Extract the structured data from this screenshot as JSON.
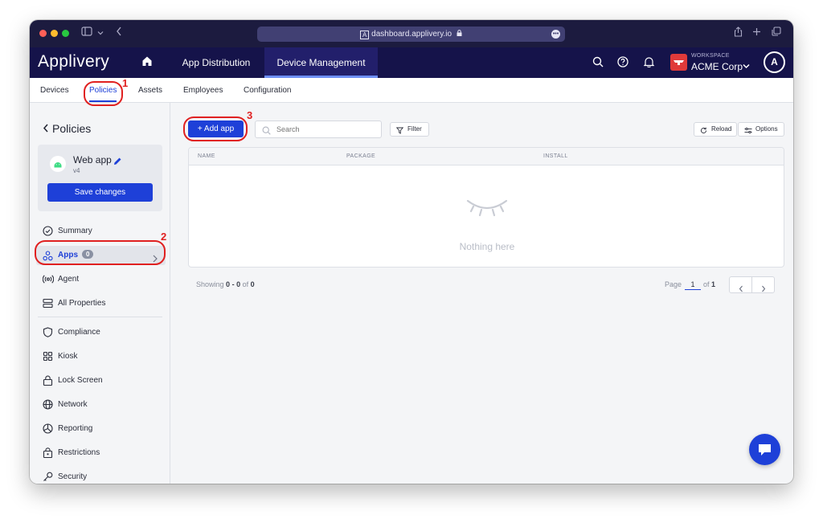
{
  "browser": {
    "url": "dashboard.applivery.io"
  },
  "header": {
    "brand": "Applivery",
    "nav": [
      "App Distribution",
      "Device Management"
    ],
    "workspace_caption": "WORKSPACE",
    "workspace_name": "ACME Corp",
    "avatar_letter": "A"
  },
  "subnav": {
    "tabs": [
      "Devices",
      "Policies",
      "Assets",
      "Employees",
      "Configuration"
    ],
    "active": "Policies"
  },
  "callouts": [
    "1",
    "2",
    "3"
  ],
  "sidebar": {
    "back_title": "Policies",
    "policy_name": "Web app",
    "policy_version": "v4",
    "save_label": "Save changes",
    "items": [
      {
        "label": "Summary",
        "icon": "check-circle-icon"
      },
      {
        "label": "Apps",
        "icon": "apps-icon",
        "badge": "0",
        "active": true
      },
      {
        "label": "Agent",
        "icon": "broadcast-icon"
      },
      {
        "label": "All Properties",
        "icon": "list-icon"
      },
      {
        "label": "Compliance",
        "icon": "shield-icon"
      },
      {
        "label": "Kiosk",
        "icon": "grid-icon"
      },
      {
        "label": "Lock Screen",
        "icon": "lock-icon"
      },
      {
        "label": "Network",
        "icon": "globe-icon"
      },
      {
        "label": "Reporting",
        "icon": "pie-chart-icon"
      },
      {
        "label": "Restrictions",
        "icon": "lock-box-icon"
      },
      {
        "label": "Security",
        "icon": "key-icon"
      }
    ]
  },
  "toolbar": {
    "add_label": "+ Add app",
    "search_placeholder": "Search",
    "filter_label": "Filter",
    "reload_label": "Reload",
    "options_label": "Options"
  },
  "table": {
    "columns": [
      "NAME",
      "PACKAGE",
      "INSTALL"
    ],
    "empty_text": "Nothing here"
  },
  "footer": {
    "showing_prefix": "Showing",
    "showing_from": "0",
    "showing_sep": "-",
    "showing_to": "0",
    "showing_of": "of",
    "showing_total": "0",
    "page_label": "Page",
    "page_value": "1",
    "page_of": "of",
    "page_total": "1"
  },
  "colors": {
    "primary": "#1e40d8",
    "header": "#15134a",
    "callout": "#e02020"
  }
}
